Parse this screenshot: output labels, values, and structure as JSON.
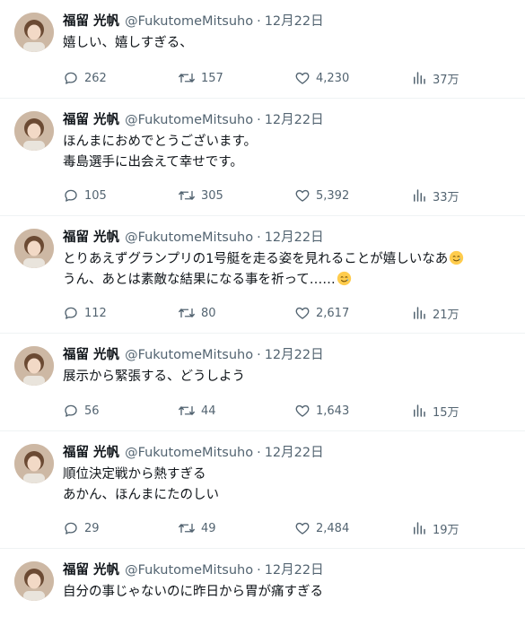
{
  "author": {
    "name": "福留 光帆",
    "handle": "@FukutomeMitsuho",
    "separator": "·"
  },
  "icons": {
    "reply": "reply-icon",
    "retweet": "retweet-icon",
    "like": "heart-icon",
    "views": "views-icon",
    "emoji": "smiling-face-with-tear-emoji"
  },
  "colors": {
    "text": "#0f1419",
    "muted": "#536471",
    "divider": "#eff3f4"
  },
  "tweets": [
    {
      "date": "12月22日",
      "lines": [
        "嬉しい、嬉しすぎる、"
      ],
      "replies": "262",
      "retweets": "157",
      "likes": "4,230",
      "views": "37万"
    },
    {
      "date": "12月22日",
      "lines": [
        "ほんまにおめでとうございます。",
        "毒島選手に出会えて幸せです。"
      ],
      "replies": "105",
      "retweets": "305",
      "likes": "5,392",
      "views": "33万"
    },
    {
      "date": "12月22日",
      "lines": [
        "とりあえずグランプリの1号艇を走る姿を見れることが嬉しいなあ",
        "うん、あとは素敵な結果になる事を祈って……"
      ],
      "replies": "112",
      "retweets": "80",
      "likes": "2,617",
      "views": "21万"
    },
    {
      "date": "12月22日",
      "lines": [
        "展示から緊張する、どうしよう"
      ],
      "replies": "56",
      "retweets": "44",
      "likes": "1,643",
      "views": "15万"
    },
    {
      "date": "12月22日",
      "lines": [
        "順位決定戦から熱すぎる",
        "あかん、ほんまにたのしい"
      ],
      "replies": "29",
      "retweets": "49",
      "likes": "2,484",
      "views": "19万"
    },
    {
      "date": "12月22日",
      "lines": [
        "自分の事じゃないのに昨日から胃が痛すぎる"
      ]
    }
  ]
}
